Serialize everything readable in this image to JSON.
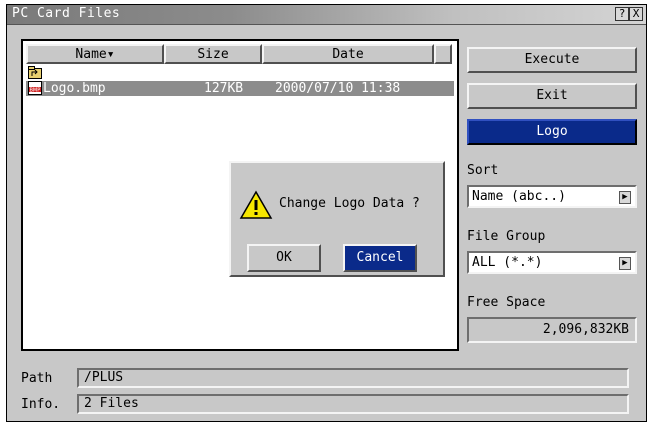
{
  "window": {
    "title": "PC Card Files",
    "help_label": "?",
    "close_label": "X"
  },
  "filelist": {
    "columns": [
      "Name▾",
      "Size",
      "Date"
    ],
    "rows": [
      {
        "name": "",
        "size": "",
        "date": "",
        "icon": "parent-folder-icon"
      },
      {
        "name": "Logo.bmp",
        "size": "127KB",
        "date": "2000/07/10 11:38",
        "icon": "bmp-file-icon",
        "selected": true
      }
    ]
  },
  "sidebar": {
    "execute_label": "Execute",
    "exit_label": "Exit",
    "logo_label": "Logo",
    "sort_label": "Sort",
    "sort_value": "Name (abc..)",
    "file_group_label": "File Group",
    "file_group_value": "ALL (*.*)",
    "free_space_label": "Free Space",
    "free_space_value": "2,096,832KB"
  },
  "footer": {
    "path_label": "Path",
    "path_value": "/PLUS",
    "info_label": "Info.",
    "info_value": "2 Files"
  },
  "dialog": {
    "message": "Change Logo Data ?",
    "ok_label": "OK",
    "cancel_label": "Cancel",
    "icon": "warning-icon"
  },
  "colors": {
    "selected_button": "#0a2a8a",
    "window_bg": "#c8c8c8"
  }
}
